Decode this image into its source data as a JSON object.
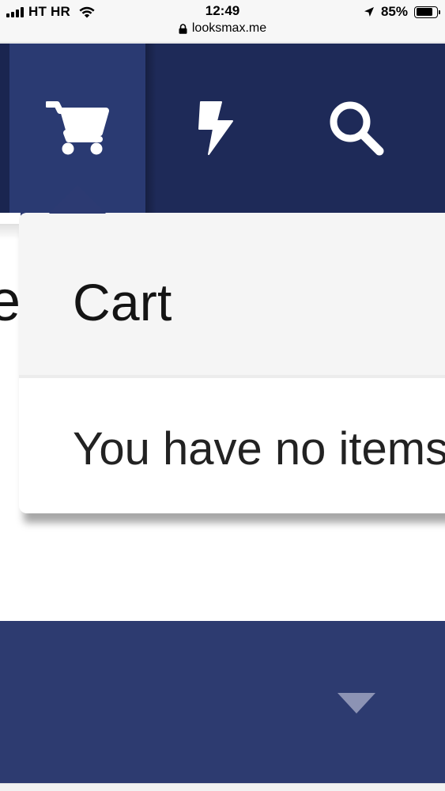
{
  "status_bar": {
    "carrier": "HT HR",
    "time": "12:49",
    "url": "looksmax.me",
    "battery": "85%",
    "battery_level": 0.85,
    "icons": [
      "signal-icon",
      "wifi-icon",
      "lock-icon",
      "location-arrow-icon",
      "battery-icon"
    ]
  },
  "navbar": {
    "background": "#1e2a58",
    "active_background": "#2a3a72",
    "items": [
      {
        "name": "cart",
        "icon": "shopping-cart-icon",
        "active": true
      },
      {
        "name": "whats-new",
        "icon": "lightning-bolt-icon",
        "active": false
      },
      {
        "name": "search",
        "icon": "search-icon",
        "active": false
      }
    ]
  },
  "page": {
    "fragment_text": "e"
  },
  "cart_menu": {
    "title": "Cart",
    "empty_message": "You have no items"
  },
  "footer": {
    "background": "#2d3b70",
    "toggle_icon": "chevron-down-icon"
  }
}
